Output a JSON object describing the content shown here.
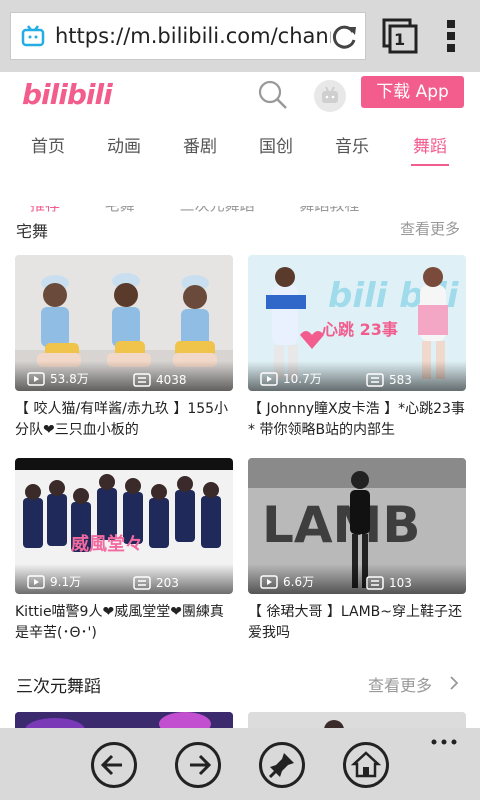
{
  "browser": {
    "url": "https://m.bilibili.com/channe",
    "tab_count": "1"
  },
  "header": {
    "logo": "bilibili",
    "download_label": "下载 App"
  },
  "nav": {
    "items": [
      {
        "label": "首页"
      },
      {
        "label": "动画"
      },
      {
        "label": "番剧"
      },
      {
        "label": "国创"
      },
      {
        "label": "音乐"
      },
      {
        "label": "舞蹈"
      }
    ],
    "active_index": 5
  },
  "cutoff": {
    "subtabs": [
      "推荐",
      "宅舞",
      "三次元舞蹈",
      "舞蹈教程"
    ],
    "section": "宅舞",
    "more": "查看更多"
  },
  "cards": [
    {
      "views": "53.8万",
      "danmaku": "4038",
      "title": "【 咬人猫/有咩酱/赤九玖 】155小分队❤三只血小板的"
    },
    {
      "views": "10.7万",
      "danmaku": "583",
      "title": "【 Johnny瞳X皮卡浩 】*心跳23事* 带你领略B站的内部生",
      "overlay_text": "心跳  23事"
    },
    {
      "views": "9.1万",
      "danmaku": "203",
      "title": "Kittie喵警9人❤威風堂堂❤團練真是辛苦(･Θ･')",
      "overlay_text": "威風堂々"
    },
    {
      "views": "6.6万",
      "danmaku": "103",
      "title": "【 徐珺大哥 】LAMB~穿上鞋子还爱我吗",
      "overlay_text": "LAMB"
    }
  ],
  "section": {
    "title": "三次元舞蹈",
    "more": "查看更多"
  },
  "colors": {
    "accent": "#f25d8e",
    "bar_bg": "#d9d9d9"
  }
}
